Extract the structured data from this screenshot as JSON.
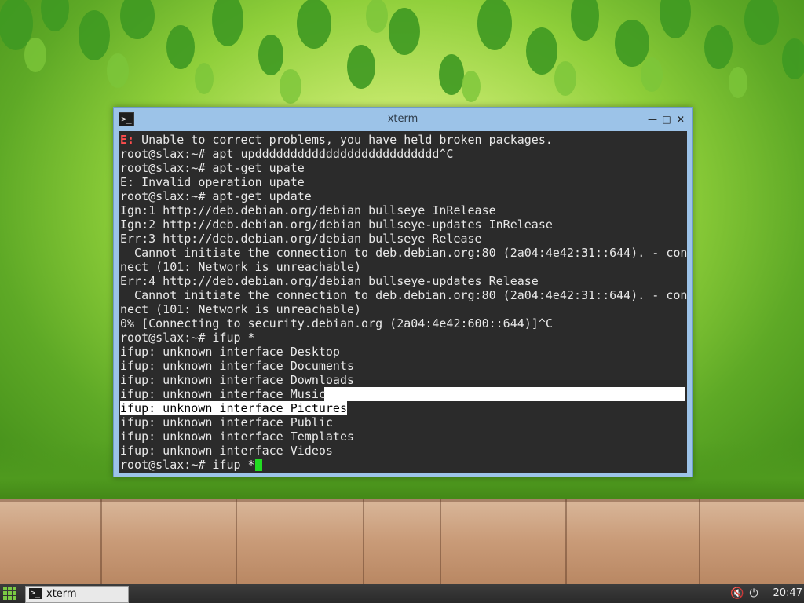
{
  "window": {
    "title": "xterm",
    "app_icon": "terminal-icon",
    "buttons": {
      "minimize": "minimize-icon",
      "maximize": "maximize-icon",
      "close": "close-icon"
    }
  },
  "terminal": {
    "error_prefix": "E:",
    "error_text": " Unable to correct problems, you have held broken packages.",
    "lines": [
      "root@slax:~# apt updddddddddddddddddddddddddd^C",
      "root@slax:~# apt-get upate",
      "E: Invalid operation upate",
      "root@slax:~# apt-get update",
      "Ign:1 http://deb.debian.org/debian bullseye InRelease",
      "Ign:2 http://deb.debian.org/debian bullseye-updates InRelease",
      "Err:3 http://deb.debian.org/debian bullseye Release",
      "  Cannot initiate the connection to deb.debian.org:80 (2a04:4e42:31::644). - con",
      "nect (101: Network is unreachable)",
      "Err:4 http://deb.debian.org/debian bullseye-updates Release",
      "  Cannot initiate the connection to deb.debian.org:80 (2a04:4e42:31::644). - con",
      "nect (101: Network is unreachable)",
      "0% [Connecting to security.debian.org (2a04:4e42:600::644)]^C",
      "root@slax:~# ifup *",
      "ifup: unknown interface Desktop",
      "ifup: unknown interface Documents",
      "ifup: unknown interface Downloads",
      "ifup: unknown interface Music",
      "ifup: unknown interface Pictures",
      "ifup: unknown interface Public",
      "ifup: unknown interface Templates",
      "ifup: unknown interface Videos"
    ],
    "prompt": "root@slax:~# ifup *"
  },
  "taskbar": {
    "start_icon": "app-grid-icon",
    "task_label": "xterm",
    "tray": [
      "volume-muted-icon",
      "power-icon"
    ],
    "clock": "20:47"
  }
}
